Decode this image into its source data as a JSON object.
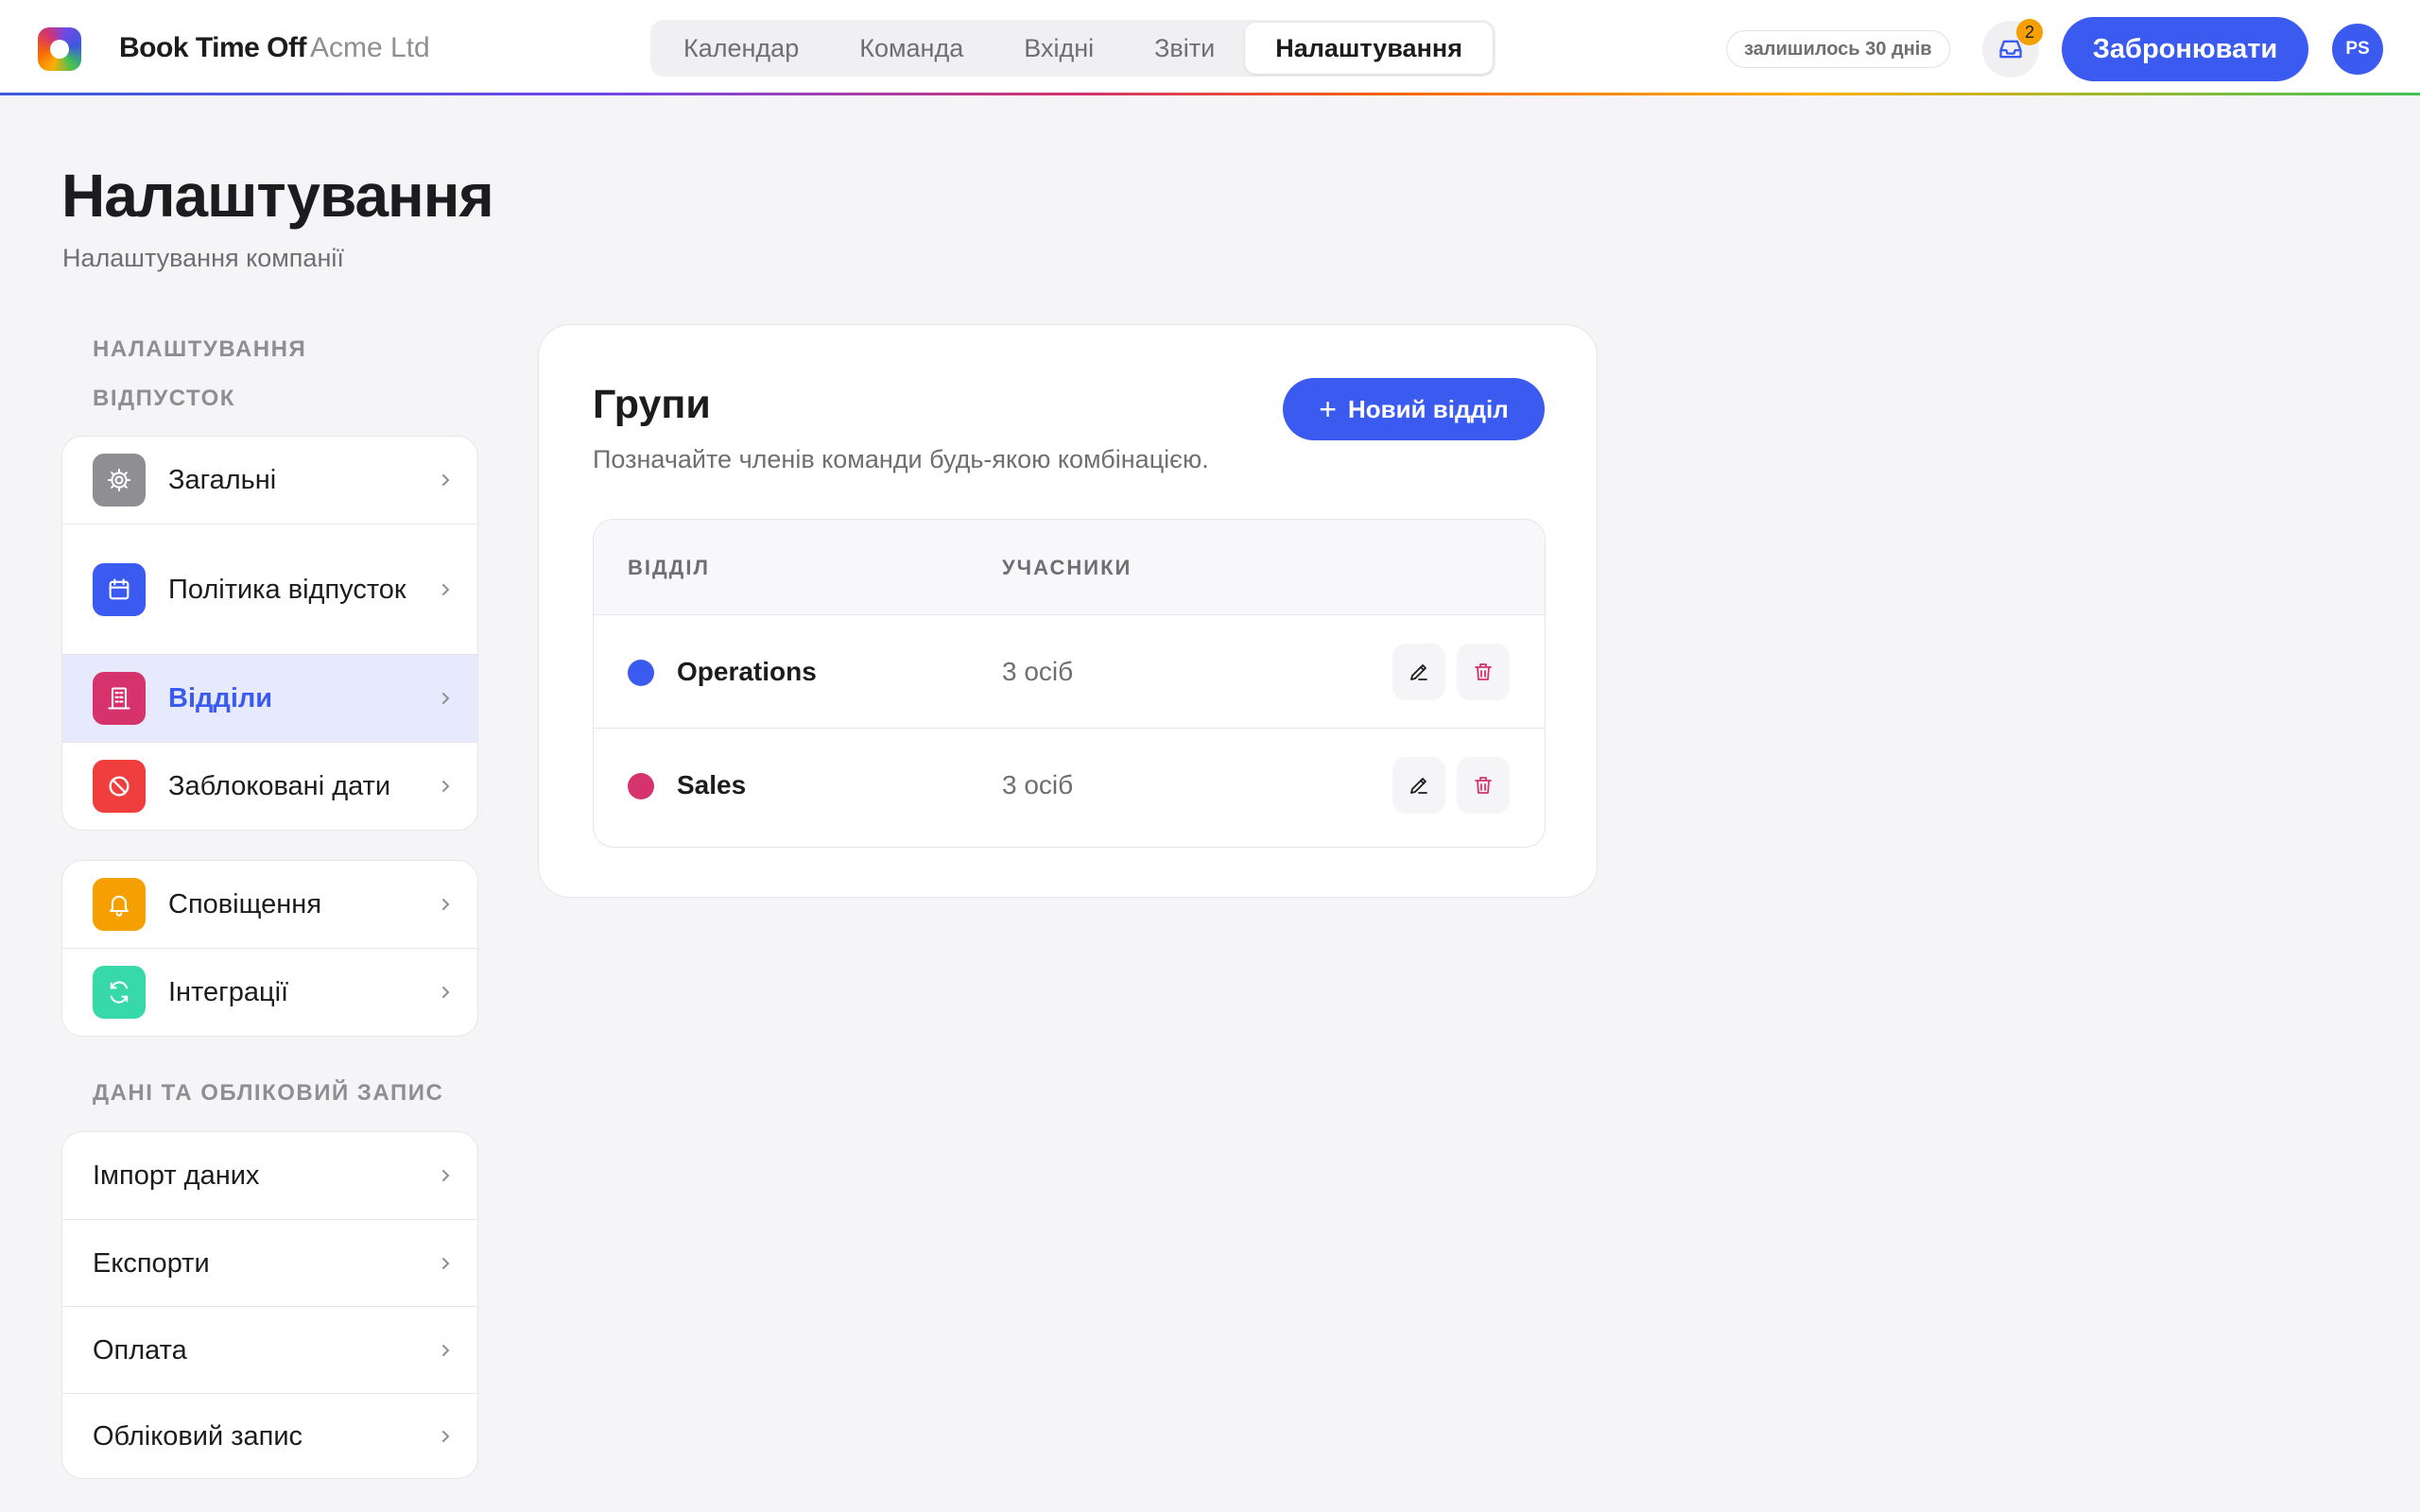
{
  "app": {
    "brand": "Book Time Off",
    "company": "Acme Ltd"
  },
  "nav": {
    "tabs": [
      {
        "label": "Календар",
        "active": false
      },
      {
        "label": "Команда",
        "active": false
      },
      {
        "label": "Вхідні",
        "active": false
      },
      {
        "label": "Звіти",
        "active": false
      },
      {
        "label": "Налаштування",
        "active": true
      }
    ]
  },
  "topbar": {
    "days_left": "залишилось 30 днів",
    "inbox_count": "2",
    "book_label": "Забронювати",
    "avatar_initials": "PS"
  },
  "header": {
    "title": "Налаштування",
    "subtitle": "Налаштування компанії"
  },
  "sidebar": {
    "section_leave": "НАЛАШТУВАННЯ ВІДПУСТОК",
    "group1": [
      {
        "label": "Загальні",
        "icon": "gear-icon",
        "color": "#8e8e93"
      },
      {
        "label": "Політика відпусток",
        "icon": "calendar-icon",
        "color": "#3b5bf0"
      },
      {
        "label": "Відділи",
        "icon": "building-icon",
        "color": "#d6336c",
        "active": true
      },
      {
        "label": "Заблоковані дати",
        "icon": "block-icon",
        "color": "#f03e3e"
      }
    ],
    "group2": [
      {
        "label": "Сповіщення",
        "icon": "bell-icon",
        "color": "#f59f00"
      },
      {
        "label": "Інтеграції",
        "icon": "sync-icon",
        "color": "#38d9a9"
      }
    ],
    "section_data": "ДАНІ ТА ОБЛІКОВИЙ ЗАПИС",
    "group3": [
      {
        "label": "Імпорт даних"
      },
      {
        "label": "Експорти"
      },
      {
        "label": "Оплата"
      },
      {
        "label": "Обліковий запис"
      }
    ]
  },
  "main": {
    "title": "Групи",
    "description": "Позначайте членів команди будь-якою комбінацією.",
    "new_button": "Новий відділ",
    "columns": [
      "ВІДДІЛ",
      "УЧАСНИКИ"
    ],
    "rows": [
      {
        "name": "Operations",
        "members": "3 осіб",
        "color": "#3b5bf0"
      },
      {
        "name": "Sales",
        "members": "3 осіб",
        "color": "#d6336c"
      }
    ]
  }
}
